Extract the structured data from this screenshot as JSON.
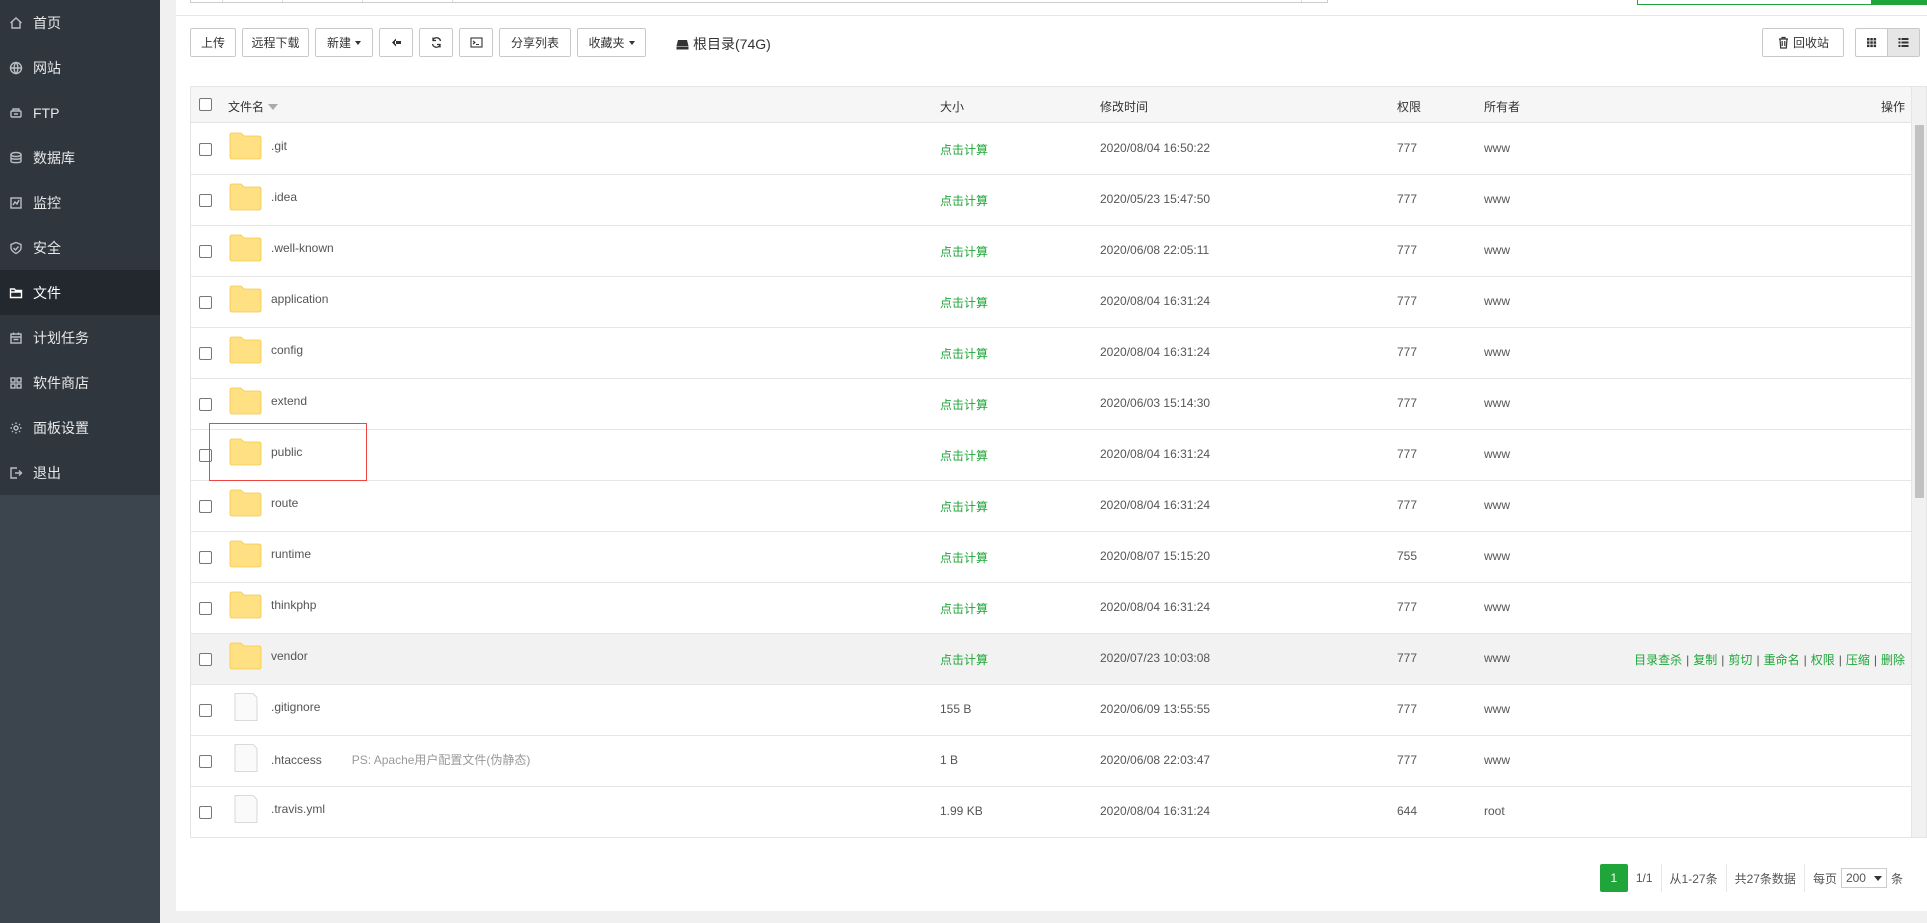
{
  "sidebar": {
    "items": [
      {
        "label": "首页",
        "icon": "home-icon"
      },
      {
        "label": "网站",
        "icon": "globe-icon"
      },
      {
        "label": "FTP",
        "icon": "ftp-icon"
      },
      {
        "label": "数据库",
        "icon": "database-icon"
      },
      {
        "label": "监控",
        "icon": "monitor-icon"
      },
      {
        "label": "安全",
        "icon": "shield-icon"
      },
      {
        "label": "文件",
        "icon": "folder-icon"
      },
      {
        "label": "计划任务",
        "icon": "calendar-icon"
      },
      {
        "label": "软件商店",
        "icon": "apps-icon"
      },
      {
        "label": "面板设置",
        "icon": "gear-icon"
      },
      {
        "label": "退出",
        "icon": "logout-icon"
      }
    ],
    "active_index": 6
  },
  "toolbar": {
    "upload": "上传",
    "remote_download": "远程下载",
    "new": "新建",
    "share_list": "分享列表",
    "favorites": "收藏夹",
    "root_label": "根目录(74G)",
    "recycle": "回收站"
  },
  "table": {
    "headers": {
      "name": "文件名",
      "size": "大小",
      "mtime": "修改时间",
      "perm": "权限",
      "owner": "所有者",
      "ops": "操作"
    },
    "calc_label": "点击计算",
    "rows": [
      {
        "name": ".git",
        "type": "folder",
        "size": "点击计算",
        "mtime": "2020/08/04 16:50:22",
        "perm": "777",
        "owner": "www"
      },
      {
        "name": ".idea",
        "type": "folder",
        "size": "点击计算",
        "mtime": "2020/05/23 15:47:50",
        "perm": "777",
        "owner": "www"
      },
      {
        "name": ".well-known",
        "type": "folder",
        "size": "点击计算",
        "mtime": "2020/06/08 22:05:11",
        "perm": "777",
        "owner": "www"
      },
      {
        "name": "application",
        "type": "folder",
        "size": "点击计算",
        "mtime": "2020/08/04 16:31:24",
        "perm": "777",
        "owner": "www"
      },
      {
        "name": "config",
        "type": "folder",
        "size": "点击计算",
        "mtime": "2020/08/04 16:31:24",
        "perm": "777",
        "owner": "www"
      },
      {
        "name": "extend",
        "type": "folder",
        "size": "点击计算",
        "mtime": "2020/06/03 15:14:30",
        "perm": "777",
        "owner": "www"
      },
      {
        "name": "public",
        "type": "folder",
        "size": "点击计算",
        "mtime": "2020/08/04 16:31:24",
        "perm": "777",
        "owner": "www"
      },
      {
        "name": "route",
        "type": "folder",
        "size": "点击计算",
        "mtime": "2020/08/04 16:31:24",
        "perm": "777",
        "owner": "www"
      },
      {
        "name": "runtime",
        "type": "folder",
        "size": "点击计算",
        "mtime": "2020/08/07 15:15:20",
        "perm": "755",
        "owner": "www"
      },
      {
        "name": "thinkphp",
        "type": "folder",
        "size": "点击计算",
        "mtime": "2020/08/04 16:31:24",
        "perm": "777",
        "owner": "www"
      },
      {
        "name": "vendor",
        "type": "folder",
        "size": "点击计算",
        "mtime": "2020/07/23 10:03:08",
        "perm": "777",
        "owner": "www",
        "hover": true
      },
      {
        "name": ".gitignore",
        "type": "file",
        "size": "155 B",
        "mtime": "2020/06/09 13:55:55",
        "perm": "777",
        "owner": "www"
      },
      {
        "name": ".htaccess",
        "type": "file",
        "size": "1 B",
        "mtime": "2020/06/08 22:03:47",
        "perm": "777",
        "owner": "www",
        "ps": "PS: Apache用户配置文件(伪静态)"
      },
      {
        "name": ".travis.yml",
        "type": "file",
        "size": "1.99 KB",
        "mtime": "2020/08/04 16:31:24",
        "perm": "644",
        "owner": "root"
      }
    ],
    "row_ops": [
      "目录查杀",
      "复制",
      "剪切",
      "重命名",
      "权限",
      "压缩",
      "删除"
    ]
  },
  "pager": {
    "current": "1",
    "pages": "1/1",
    "range": "从1-27条",
    "total": "共27条数据",
    "per_page_label": "每页",
    "per_page_value": "200",
    "unit": "条"
  },
  "colors": {
    "accent": "#20a53a",
    "sidebar_bg": "#3c444d",
    "sidebar_active": "#22282e",
    "folder": "#ffe083",
    "highlight_border": "#e44444"
  }
}
